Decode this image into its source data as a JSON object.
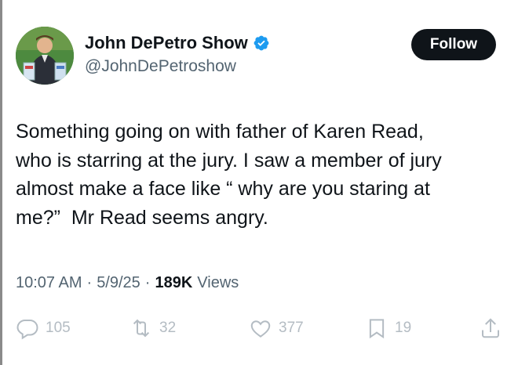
{
  "author": {
    "display_name": "John DePetro Show",
    "handle": "@JohnDePetroshow",
    "verified": true,
    "verified_color": "#1d9bf0"
  },
  "follow_label": "Follow",
  "tweet": {
    "text": "Something going on with father of Karen Read,\nwho is starring at the jury. I saw a member of jury\nalmost make a face like “ why are you staring at\nme?”  Mr Read seems angry.",
    "time": "10:07 AM",
    "date": "5/9/25",
    "views_count": "189K",
    "views_label": "Views"
  },
  "actions": {
    "replies": "105",
    "reposts": "32",
    "likes": "377",
    "bookmarks": "19"
  },
  "icons": [
    "reply-icon",
    "repost-icon",
    "like-icon",
    "bookmark-icon",
    "share-icon",
    "verified-badge-icon"
  ]
}
